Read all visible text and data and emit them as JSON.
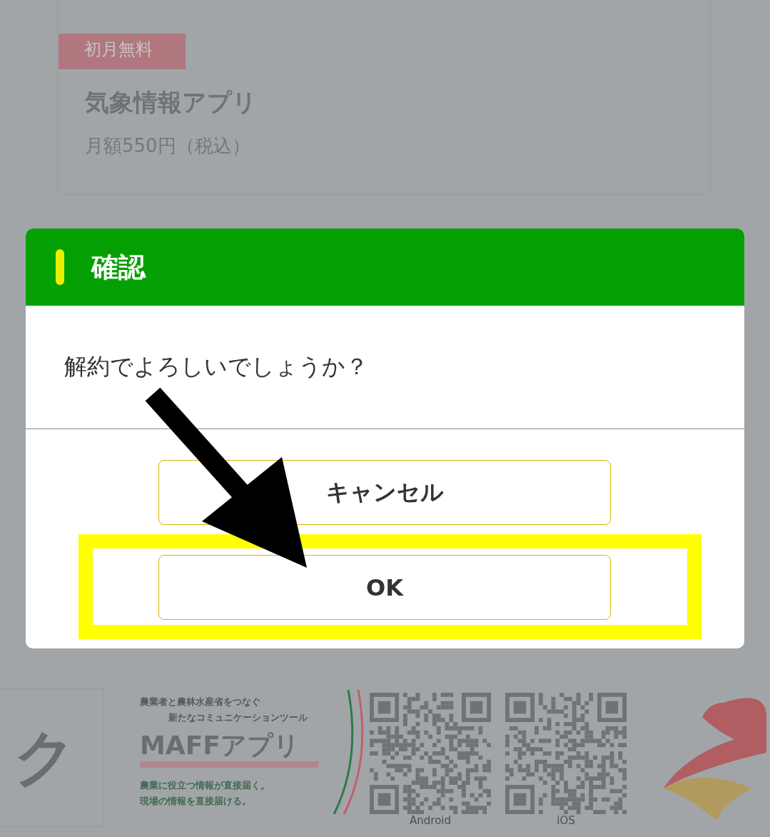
{
  "card": {
    "badge": "初月無料",
    "title": "気象情報アプリ",
    "price": "月額550円（税込）"
  },
  "banner": {
    "logo_text": "ク",
    "tagline": [
      "農業者と農林水産省をつなぐ",
      "新たなコミュニケーションツール"
    ],
    "app_name": "MAFFアプリ",
    "description": [
      "農業に役立つ情報が直接届く。",
      "現場の情報を直接届ける。"
    ],
    "qr_codes": [
      {
        "label": "Android"
      },
      {
        "label": "iOS"
      }
    ]
  },
  "dialog": {
    "title": "確認",
    "message": "解約でよろしいでしょうか？",
    "buttons": [
      {
        "label": "キャンセル",
        "highlighted": false
      },
      {
        "label": "OK",
        "highlighted": true
      }
    ]
  }
}
